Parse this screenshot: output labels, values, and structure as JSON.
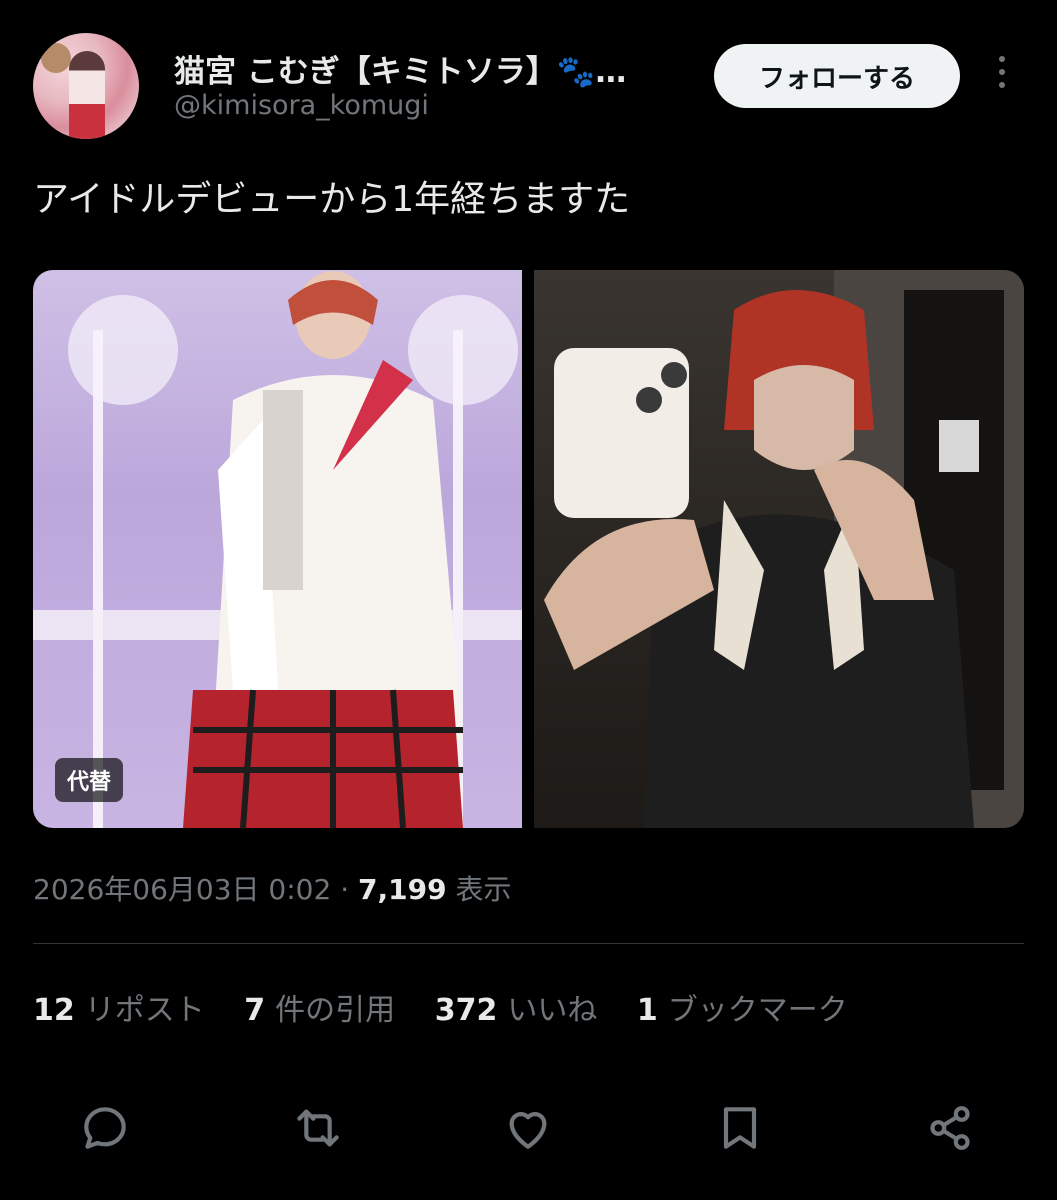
{
  "author": {
    "display_name": "猫宮 こむぎ【キミトソラ】🐾…",
    "handle": "@kimisora_komugi"
  },
  "follow_button": {
    "label": "フォローする"
  },
  "tweet": {
    "text": "アイドルデビューから1年経ちますた"
  },
  "media": {
    "alt_badge": "代替"
  },
  "meta": {
    "timestamp": "2026年06月03日 0:02",
    "separator": " · ",
    "views_count": "7,199",
    "views_label": " 表示"
  },
  "stats": [
    {
      "num": "12",
      "label": "リポスト"
    },
    {
      "num": "7",
      "label": "件の引用"
    },
    {
      "num": "372",
      "label": "いいね"
    },
    {
      "num": "1",
      "label": "ブックマーク"
    }
  ],
  "actions": [
    {
      "name": "reply-icon"
    },
    {
      "name": "repost-icon"
    },
    {
      "name": "like-icon"
    },
    {
      "name": "bookmark-icon"
    },
    {
      "name": "share-icon"
    }
  ],
  "colors": {
    "background": "#000000",
    "text": "#e7e9ea",
    "secondary": "#71767b",
    "follow_bg": "#eff3f4"
  }
}
